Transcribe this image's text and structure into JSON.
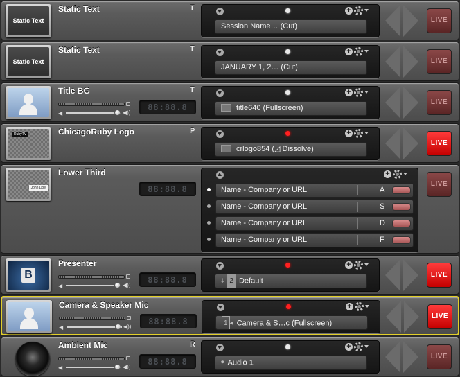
{
  "layers": [
    {
      "name": "Static Text",
      "tag": "T",
      "thumb": "Static Text",
      "thumbStyle": "text",
      "active": false,
      "live": false,
      "selected": false,
      "source": "Session Name… (Cut)",
      "sourceIcon": "none",
      "hasAudio": false,
      "timer": null,
      "volume": null
    },
    {
      "name": "Static Text",
      "tag": "T",
      "thumb": "Static Text",
      "thumbStyle": "text",
      "active": false,
      "live": false,
      "selected": false,
      "source": "JANUARY 1, 2… (Cut)",
      "sourceIcon": "none",
      "hasAudio": false,
      "timer": null,
      "volume": null
    },
    {
      "name": "Title BG",
      "tag": "T",
      "thumb": "",
      "thumbStyle": "person",
      "active": false,
      "live": false,
      "selected": false,
      "source": "title640 (Fullscreen)",
      "sourceIcon": "image-icon",
      "hasAudio": true,
      "timer": "88:88.8",
      "volume": 0.92
    },
    {
      "name": "ChicagoRuby Logo",
      "tag": "P",
      "thumb": "RubyTV",
      "thumbStyle": "logo",
      "active": true,
      "live": true,
      "selected": false,
      "source": "crlogo854 (◿ Dissolve)",
      "sourceIcon": "image-icon",
      "hasAudio": false,
      "timer": null,
      "volume": null
    },
    {
      "name": "Presenter",
      "tag": "",
      "thumb": "B",
      "thumbStyle": "screen",
      "active": true,
      "live": true,
      "selected": false,
      "source": "Default",
      "sourceIcon": "download-icon",
      "sourceNum": "2",
      "hasAudio": true,
      "timer": "88:88.8",
      "volume": 0.92
    },
    {
      "name": "Camera & Speaker Mic",
      "tag": "",
      "thumb": "",
      "thumbStyle": "person",
      "active": true,
      "live": true,
      "selected": true,
      "source": "Camera & S…c (Fullscreen)",
      "sourceIcon": "camera-icon",
      "sourceNum": "1",
      "hasAudio": true,
      "timer": "88:88.8",
      "volume": 0.92
    },
    {
      "name": "Ambient Mic",
      "tag": "R",
      "thumb": "",
      "thumbStyle": "speaker",
      "active": false,
      "live": false,
      "selected": false,
      "source": "Audio 1",
      "sourceIcon": "mic-icon",
      "hasAudio": true,
      "timer": "88:88.8",
      "volume": 0.92
    }
  ],
  "lowerThird": {
    "name": "Lower Third",
    "timer": "88:88.8",
    "thumbText": "John Doe",
    "live": false,
    "rows": [
      {
        "text": "Name - Company or URL",
        "key": "A",
        "on": true
      },
      {
        "text": "Name - Company or URL",
        "key": "S",
        "on": false
      },
      {
        "text": "Name - Company or URL",
        "key": "D",
        "on": false
      },
      {
        "text": "Name - Company or URL",
        "key": "F",
        "on": false
      }
    ]
  },
  "labels": {
    "live": "LIVE",
    "plus": "+"
  }
}
